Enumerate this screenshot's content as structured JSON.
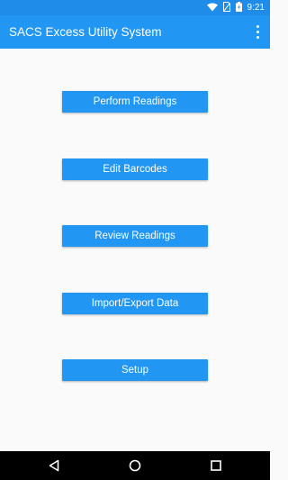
{
  "status_bar": {
    "time": "9:21"
  },
  "app_bar": {
    "title": "SACS Excess Utility System"
  },
  "menu": {
    "buttons": [
      {
        "label": "Perform Readings"
      },
      {
        "label": "Edit Barcodes"
      },
      {
        "label": "Review Readings"
      },
      {
        "label": "Import/Export Data"
      },
      {
        "label": "Setup"
      }
    ]
  },
  "colors": {
    "primary": "#2196f3",
    "primary_dark": "#1e8ce8",
    "background": "#fafafa",
    "nav_bar": "#000000"
  },
  "icons": {
    "status": [
      "wifi-icon",
      "no-sim-icon",
      "battery-charging-icon"
    ],
    "app_bar": [
      "overflow-menu-icon"
    ],
    "nav": [
      "back-icon",
      "home-icon",
      "recents-icon"
    ]
  }
}
